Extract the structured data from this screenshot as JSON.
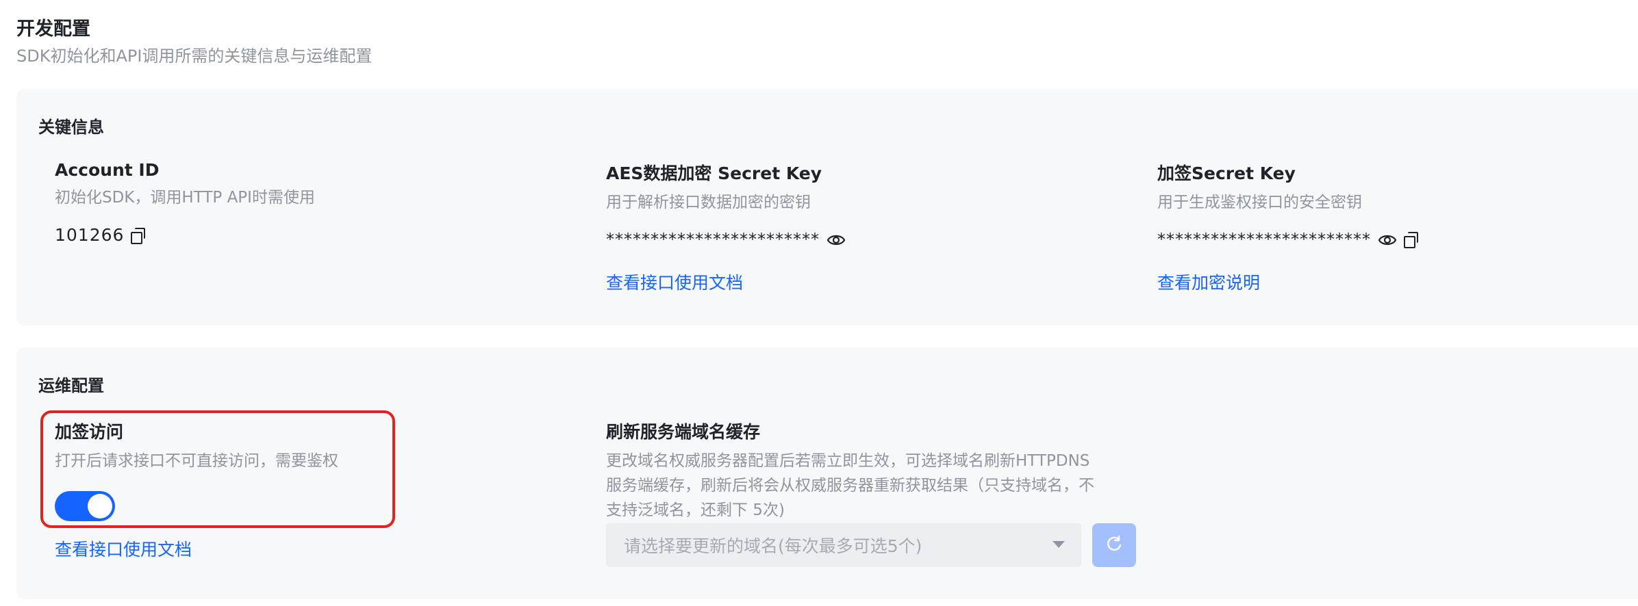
{
  "header": {
    "title": "开发配置",
    "subtitle": "SDK初始化和API调用所需的关键信息与运维配置"
  },
  "key_info": {
    "title": "关键信息",
    "account": {
      "label": "Account ID",
      "desc": "初始化SDK，调用HTTP API时需使用",
      "value": "101266",
      "copy_icon": "copy-icon"
    },
    "aes": {
      "label": "AES数据加密 Secret Key",
      "desc": "用于解析接口数据加密的密钥",
      "value": "************************",
      "eye_icon": "eye-icon",
      "link": "查看接口使用文档"
    },
    "sign": {
      "label": "加签Secret Key",
      "desc": "用于生成鉴权接口的安全密钥",
      "value": "************************",
      "eye_icon": "eye-icon",
      "copy_icon": "copy-icon",
      "link": "查看加密说明"
    }
  },
  "ops": {
    "title": "运维配置",
    "signed_access": {
      "label": "加签访问",
      "desc": "打开后请求接口不可直接访问，需要鉴权",
      "enabled": true,
      "link": "查看接口使用文档"
    },
    "refresh_cache": {
      "label": "刷新服务端域名缓存",
      "desc_line1": "更改域名权威服务器配置后若需立即生效，可选择域名刷新HTTPDNS",
      "desc_line2": "服务端缓存，刷新后将会从权威服务器重新获取结果（只支持域名，不",
      "desc_line3": "支持泛域名，还剩下 5次)",
      "select_placeholder": "请选择要更新的域名(每次最多可选5个)",
      "refresh_icon": "refresh-icon"
    }
  },
  "colors": {
    "accent": "#1664ff",
    "highlight": "#e0251f",
    "card_bg": "#f7f8fa",
    "muted": "#8f959e"
  }
}
